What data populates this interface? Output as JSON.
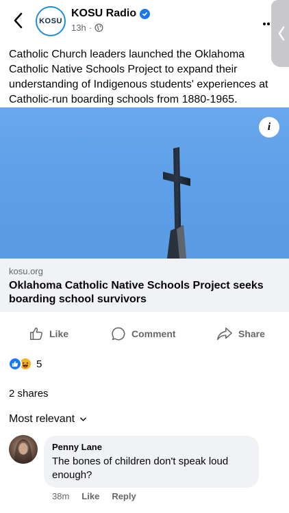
{
  "header": {
    "page_name": "KOSU Radio",
    "avatar_text": "KOSU",
    "time": "13h",
    "separator": "·"
  },
  "post": {
    "text": "Catholic Church leaders launched the Oklahoma Catholic Native Schools Project to expand their understanding of Indigenous students' experiences at Catholic-run boarding schools from 1880-1965."
  },
  "link": {
    "info_label": "i",
    "domain": "kosu.org",
    "title": "Oklahoma Catholic Native Schools Project seeks boarding school survivors"
  },
  "actions": {
    "like": "Like",
    "comment": "Comment",
    "share": "Share"
  },
  "reactions": {
    "count": "5",
    "types": [
      "like",
      "haha"
    ]
  },
  "shares": "2 shares",
  "sort_label": "Most relevant",
  "comments": [
    {
      "name": "Penny Lane",
      "text": "The bones of children don't speak loud enough?",
      "time": "38m",
      "like": "Like",
      "reply": "Reply"
    }
  ],
  "colors": {
    "accent": "#1877f2",
    "secondary_text": "#65676b",
    "preview_bg": "#f0f2f5",
    "sky": "#5c9ee8"
  }
}
